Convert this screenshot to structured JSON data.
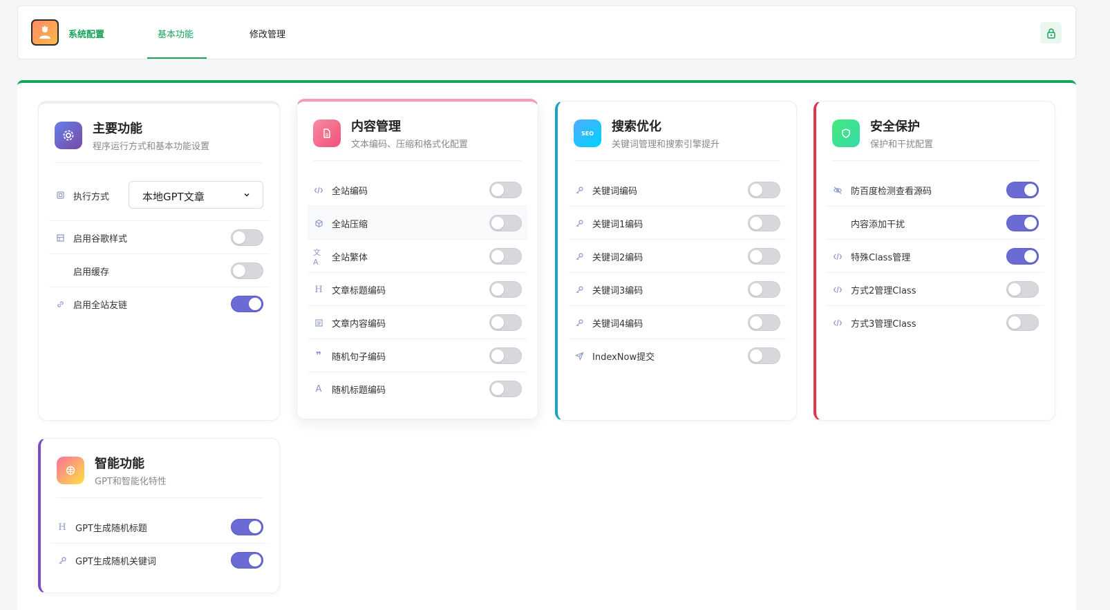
{
  "nav": {
    "brand": "系统配置",
    "tabs": [
      {
        "label": "基本功能",
        "active": true
      },
      {
        "label": "修改管理",
        "active": false
      }
    ]
  },
  "accent_color": "#16a35a",
  "toggle_on_color": "#6b6bd6",
  "cards": {
    "main": {
      "title": "主要功能",
      "subtitle": "程序运行方式和基本功能设置",
      "select": {
        "label": "执行方式",
        "value": "本地GPT文章"
      },
      "items": [
        {
          "label": "启用谷歌样式",
          "icon": "layout-icon",
          "on": false
        },
        {
          "label": "启用缓存",
          "icon": "",
          "on": false
        },
        {
          "label": "启用全站友链",
          "icon": "link-icon",
          "on": true
        }
      ]
    },
    "content": {
      "title": "内容管理",
      "subtitle": "文本编码、压缩和格式化配置",
      "items": [
        {
          "label": "全站编码",
          "icon": "code-icon",
          "on": false
        },
        {
          "label": "全站压缩",
          "icon": "cube-icon",
          "on": false
        },
        {
          "label": "全站繁体",
          "icon": "translate-icon",
          "on": false
        },
        {
          "label": "文章标题编码",
          "icon": "heading-icon",
          "on": false
        },
        {
          "label": "文章内容编码",
          "icon": "document-lines-icon",
          "on": false
        },
        {
          "label": "随机句子编码",
          "icon": "quote-icon",
          "on": false
        },
        {
          "label": "随机标题编码",
          "icon": "font-icon",
          "on": false
        }
      ]
    },
    "seo": {
      "title": "搜索优化",
      "subtitle": "关键词管理和搜索引擎提升",
      "icon_text": "SEO",
      "items": [
        {
          "label": "关键词编码",
          "icon": "key-icon",
          "on": false
        },
        {
          "label": "关键词1编码",
          "icon": "key-icon",
          "on": false
        },
        {
          "label": "关键词2编码",
          "icon": "key-icon",
          "on": false
        },
        {
          "label": "关键词3编码",
          "icon": "key-icon",
          "on": false
        },
        {
          "label": "关键词4编码",
          "icon": "key-icon",
          "on": false
        },
        {
          "label": "IndexNow提交",
          "icon": "send-icon",
          "on": false
        }
      ]
    },
    "security": {
      "title": "安全保护",
      "subtitle": "保护和干扰配置",
      "items": [
        {
          "label": "防百度检测查看源码",
          "icon": "eye-off-icon",
          "on": true
        },
        {
          "label": "内容添加干扰",
          "icon": "",
          "on": true
        },
        {
          "label": "特殊Class管理",
          "icon": "code-icon",
          "on": true
        },
        {
          "label": "方式2管理Class",
          "icon": "code-icon",
          "on": false
        },
        {
          "label": "方式3管理Class",
          "icon": "code-icon",
          "on": false
        }
      ]
    },
    "ai": {
      "title": "智能功能",
      "subtitle": "GPT和智能化特性",
      "items": [
        {
          "label": "GPT生成随机标题",
          "icon": "heading-icon",
          "on": true
        },
        {
          "label": "GPT生成随机关键词",
          "icon": "key-icon",
          "on": true
        }
      ]
    }
  }
}
